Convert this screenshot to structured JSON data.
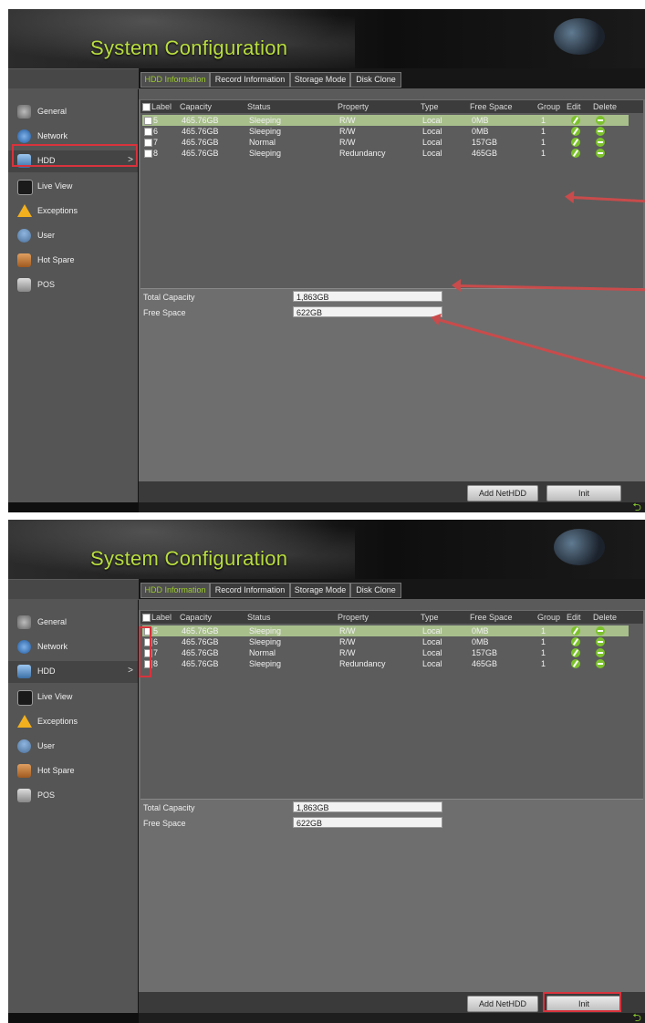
{
  "app": {
    "title": "System Configuration"
  },
  "tabs": [
    {
      "label": "HDD Information"
    },
    {
      "label": "Record Information"
    },
    {
      "label": "Storage Mode"
    },
    {
      "label": "Disk Clone"
    }
  ],
  "sidebar": {
    "items": [
      {
        "label": "General"
      },
      {
        "label": "Network"
      },
      {
        "label": "HDD"
      },
      {
        "label": "Live View"
      },
      {
        "label": "Exceptions"
      },
      {
        "label": "User"
      },
      {
        "label": "Hot Spare"
      },
      {
        "label": "POS"
      }
    ],
    "active_chevron": ">"
  },
  "table": {
    "columns": [
      "Label",
      "Capacity",
      "Status",
      "Property",
      "Type",
      "Free Space",
      "Group",
      "Edit",
      "Delete"
    ],
    "rows": [
      {
        "label": "5",
        "capacity": "465.76GB",
        "status": "Sleeping",
        "property": "R/W",
        "type": "Local",
        "free_space": "0MB",
        "group": "1"
      },
      {
        "label": "6",
        "capacity": "465.76GB",
        "status": "Sleeping",
        "property": "R/W",
        "type": "Local",
        "free_space": "0MB",
        "group": "1"
      },
      {
        "label": "7",
        "capacity": "465.76GB",
        "status": "Normal",
        "property": "R/W",
        "type": "Local",
        "free_space": "157GB",
        "group": "1"
      },
      {
        "label": "8",
        "capacity": "465.76GB",
        "status": "Sleeping",
        "property": "Redundancy",
        "type": "Local",
        "free_space": "465GB",
        "group": "1"
      }
    ]
  },
  "summary": {
    "total_capacity_label": "Total Capacity",
    "total_capacity_value": "1,863GB",
    "free_space_label": "Free Space",
    "free_space_value": "622GB"
  },
  "buttons": {
    "add_nethdd": "Add NetHDD",
    "init": "Init"
  },
  "icons": {
    "back": "back-arrow-icon",
    "edit": "edit-icon",
    "delete": "delete-icon"
  },
  "colors": {
    "title_green": "#b9de3f",
    "active_tab_green": "#9ccb2e",
    "highlight_red": "#d8333d",
    "selected_row": "#a8bf8c"
  }
}
